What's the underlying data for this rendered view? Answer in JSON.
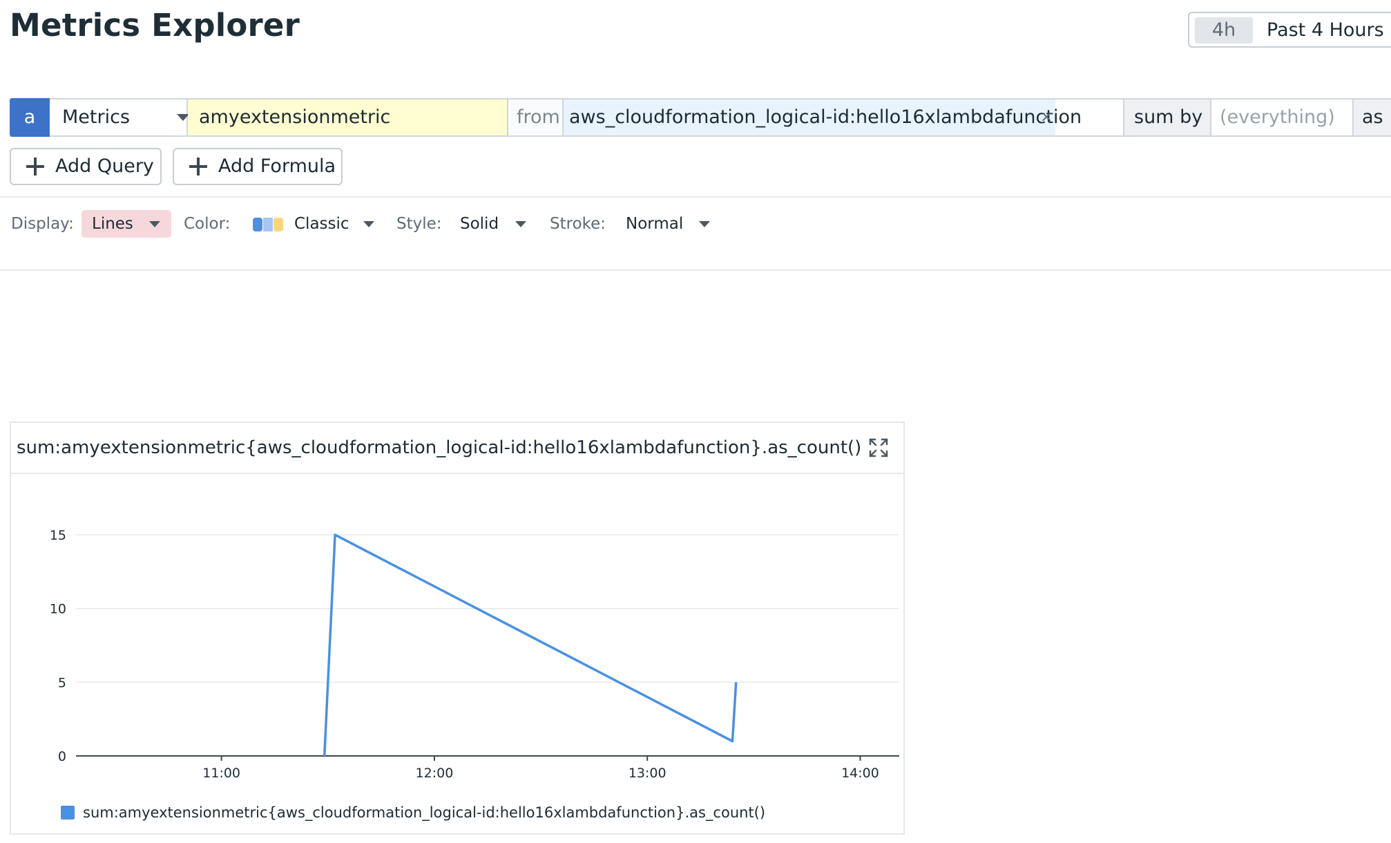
{
  "header": {
    "title": "Metrics Explorer",
    "time_badge": "4h",
    "time_label": "Past 4 Hours"
  },
  "query": {
    "letter": "a",
    "source": "Metrics",
    "metric": "amyextensionmetric",
    "from_label": "from",
    "tag": "aws_cloudformation_logical-id:hello16xlambdafunction",
    "tag_close": "×",
    "agg_label": "sum by",
    "group_placeholder": "(everything)",
    "as_label": "as"
  },
  "actions": {
    "add_query": "Add Query",
    "add_formula": "Add Formula"
  },
  "options": {
    "display_label": "Display:",
    "display_value": "Lines",
    "color_label": "Color:",
    "color_value": "Classic",
    "style_label": "Style:",
    "style_value": "Solid",
    "stroke_label": "Stroke:",
    "stroke_value": "Normal",
    "palette_colors": [
      "#4f8fe0",
      "#a7c6f2",
      "#f7d67a"
    ]
  },
  "graph": {
    "title": "sum:amyextensionmetric{aws_cloudformation_logical-id:hello16xlambdafunction}.as_count()",
    "expand_icon": "expand-icon"
  },
  "chart_data": {
    "type": "line",
    "title": "",
    "xlabel": "",
    "ylabel": "",
    "x_ticks": [
      "11:00",
      "12:00",
      "13:00",
      "14:00"
    ],
    "y_ticks": [
      0,
      5,
      10,
      15
    ],
    "xlim": [
      "10:19",
      "14:11"
    ],
    "ylim": [
      0,
      15
    ],
    "grid": true,
    "legend": "bottom-left",
    "series": [
      {
        "name": "sum:amyextensionmetric{aws_cloudformation_logical-id:hello16xlambdafunction}.as_count()",
        "color": "#4a90e2",
        "points": [
          [
            "11:29",
            0
          ],
          [
            "11:32",
            15
          ],
          [
            "13:24",
            1
          ],
          [
            "13:25",
            5
          ]
        ]
      }
    ]
  }
}
